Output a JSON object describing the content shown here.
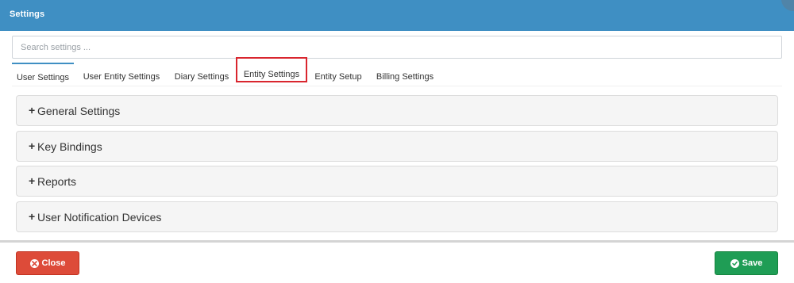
{
  "header": {
    "title": "Settings"
  },
  "search": {
    "placeholder": "Search settings ..."
  },
  "tabs": [
    {
      "label": "User Settings",
      "active": true
    },
    {
      "label": "User Entity Settings"
    },
    {
      "label": "Diary Settings"
    },
    {
      "label": "Entity Settings",
      "highlighted": true
    },
    {
      "label": "Entity Setup"
    },
    {
      "label": "Billing Settings"
    }
  ],
  "panels": [
    {
      "label": "General Settings"
    },
    {
      "label": "Key Bindings"
    },
    {
      "label": "Reports"
    },
    {
      "label": "User Notification Devices"
    }
  ],
  "panel_expand_symbol": "+",
  "footer": {
    "close_label": "Close",
    "save_label": "Save"
  },
  "colors": {
    "header": "#3f8fc3",
    "highlight_box": "#d9262e",
    "close_button": "#dd4b39",
    "save_button": "#1f9d55"
  },
  "icons": {
    "close": "close-circle-icon",
    "save": "check-circle-icon"
  }
}
